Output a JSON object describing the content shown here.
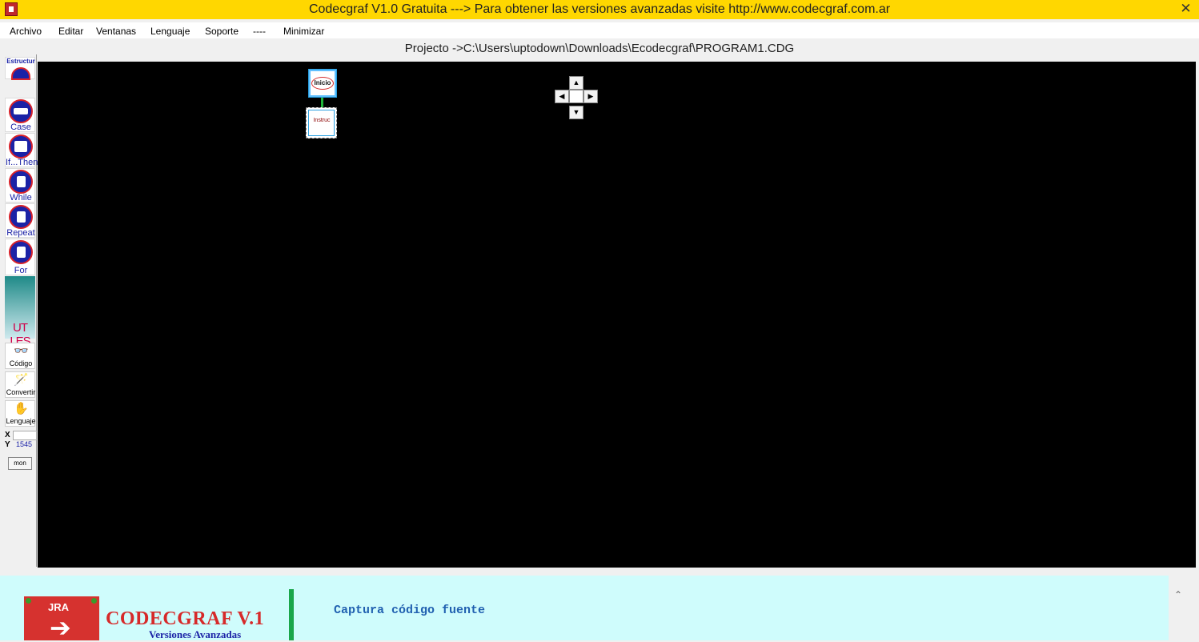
{
  "window": {
    "title": "Codecgraf V1.0 Gratuita ---> Para obtener las versiones avanzadas visite http://www.codecgraf.com.ar",
    "close_glyph": "✕"
  },
  "menu": {
    "items": [
      "Archivo",
      "Editar",
      "Ventanas",
      "Lenguaje",
      "Soporte",
      "----",
      "Minimizar"
    ]
  },
  "project": {
    "path": "Projecto ->C:\\Users\\uptodown\\Downloads\\Ecodecgraf\\PROGRAM1.CDG"
  },
  "toolbar": {
    "estructura": "Estructur",
    "tools": [
      "Case",
      "If...Then",
      "While",
      "Repeat",
      "For"
    ],
    "utiles": "UT LES",
    "codigo": "Código",
    "convertir": "Convertir",
    "lenguaje": "Lenguaje",
    "x_label": "X",
    "y_label": "Y",
    "y_value": "1545",
    "mon": "mon"
  },
  "canvas": {
    "nodes": {
      "inicio": "Inicio",
      "instruc": "Instruc"
    },
    "nav": {
      "up": "▲",
      "down": "▼",
      "left": "◀",
      "right": "▶"
    }
  },
  "banner": {
    "logo_jra": "JRA",
    "logo_arrow": "➔",
    "logo_title": "CODECGRAF V.1",
    "logo_sub": "Versiones Avanzadas",
    "caption": "Captura código fuente",
    "scroll_up": "⌃"
  },
  "colors": {
    "titlebar": "#ffd700",
    "canvas": "#000000",
    "banner": "#cffcfc",
    "tool_blue": "#1b22a6",
    "tool_red": "#d8222a"
  }
}
